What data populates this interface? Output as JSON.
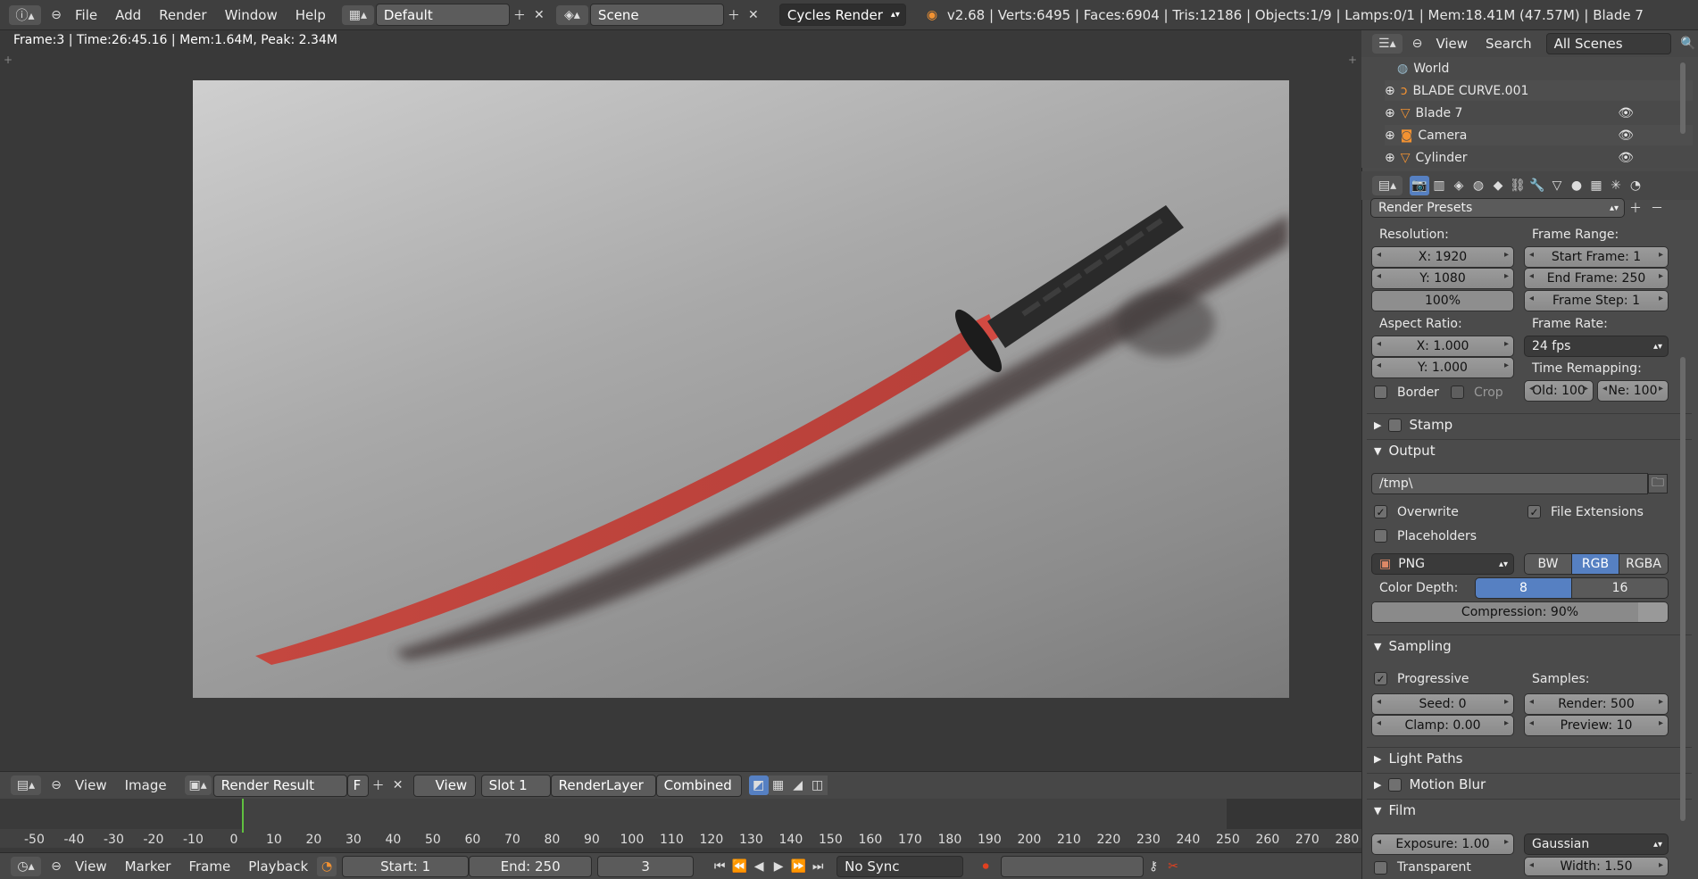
{
  "topbar": {
    "menus": [
      "File",
      "Add",
      "Render",
      "Window",
      "Help"
    ],
    "layout": "Default",
    "scene": "Scene",
    "engine": "Cycles Render",
    "stats": "v2.68 | Verts:6495 | Faces:6904 | Tris:12186 | Objects:1/9 | Lamps:0/1 | Mem:18.41M (47.57M) | Blade 7"
  },
  "viewport": {
    "info": "Frame:3 | Time:26:45.16 | Mem:1.64M, Peak: 2.34M"
  },
  "image_header": {
    "view": "View",
    "image": "Image",
    "image_name": "Render Result",
    "fake_user": "F",
    "view_menu": "View",
    "slot": "Slot 1",
    "layer": "RenderLayer",
    "pass": "Combined"
  },
  "timeline": {
    "ticks": [
      "-50",
      "-40",
      "-30",
      "-20",
      "-10",
      "0",
      "10",
      "20",
      "30",
      "40",
      "50",
      "60",
      "70",
      "80",
      "90",
      "100",
      "110",
      "120",
      "130",
      "140",
      "150",
      "160",
      "170",
      "180",
      "190",
      "200",
      "210",
      "220",
      "230",
      "240",
      "250",
      "260",
      "270",
      "280"
    ],
    "current_frame": 3
  },
  "timeline_header": {
    "view": "View",
    "marker": "Marker",
    "frame": "Frame",
    "playback": "Playback",
    "start": "Start: 1",
    "end": "End: 250",
    "frame_value": "3",
    "sync": "No Sync"
  },
  "outliner": {
    "view": "View",
    "search": "Search",
    "scenes": "All Scenes",
    "items": [
      "World",
      "BLADE CURVE.001",
      "Blade 7",
      "Camera",
      "Cylinder"
    ]
  },
  "properties": {
    "presets": "Render Presets",
    "resolution_label": "Resolution:",
    "res_x": "X: 1920",
    "res_y": "Y: 1080",
    "res_pct": "100%",
    "frame_range_label": "Frame Range:",
    "start_frame": "Start Frame: 1",
    "end_frame": "End Frame: 250",
    "frame_step": "Frame Step: 1",
    "aspect_label": "Aspect Ratio:",
    "aspect_x": "X: 1.000",
    "aspect_y": "Y: 1.000",
    "frame_rate_label": "Frame Rate:",
    "frame_rate": "24 fps",
    "time_remap_label": "Time Remapping:",
    "old": "Old: 100",
    "new": "Ne: 100",
    "border": "Border",
    "crop": "Crop",
    "stamp": "Stamp",
    "output": "Output",
    "path": "/tmp\\",
    "overwrite": "Overwrite",
    "file_ext": "File Extensions",
    "placeholders": "Placeholders",
    "format": "PNG",
    "bw": "BW",
    "rgb": "RGB",
    "rgba": "RGBA",
    "color_depth_label": "Color Depth:",
    "depth_8": "8",
    "depth_16": "16",
    "compression": "Compression: 90%",
    "compression_value": 0.9,
    "sampling": "Sampling",
    "progressive": "Progressive",
    "samples_label": "Samples:",
    "seed": "Seed: 0",
    "clamp": "Clamp: 0.00",
    "render_samples": "Render: 500",
    "preview_samples": "Preview: 10",
    "light_paths": "Light Paths",
    "motion_blur": "Motion Blur",
    "film": "Film",
    "exposure": "Exposure: 1.00",
    "filter": "Gaussian",
    "transparent": "Transparent",
    "width": "Width: 1.50"
  }
}
